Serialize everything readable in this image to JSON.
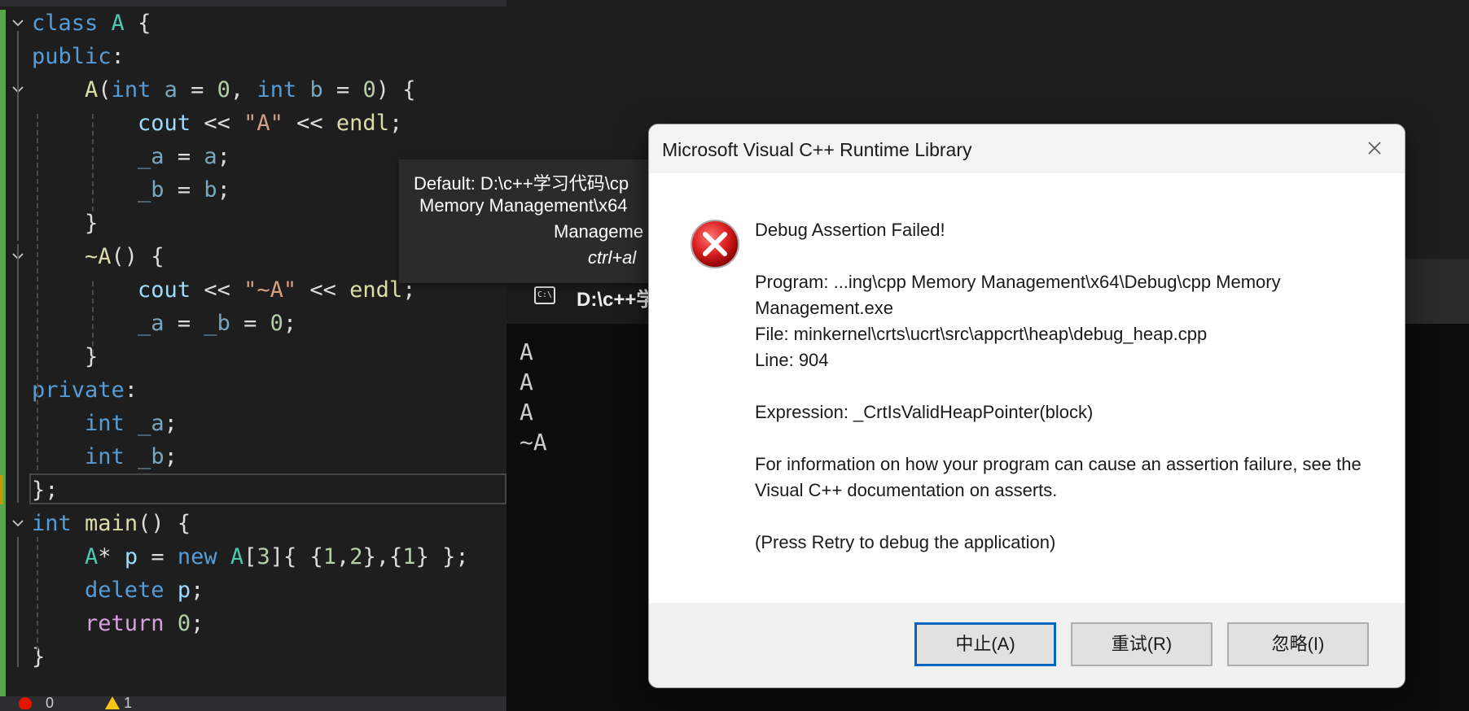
{
  "editor": {
    "lines": [
      {
        "fold": true,
        "html": "<span class=\"kw\">class</span> <span class=\"cls\">A</span> {"
      },
      {
        "fold": false,
        "html": "<span class=\"kw\">public</span>:"
      },
      {
        "fold": true,
        "html": "    <span class=\"fn\">A</span>(<span class=\"kw\">int</span> <span class=\"var dim\">a</span> = <span class=\"num\">0</span>, <span class=\"kw\">int</span> <span class=\"var dim\">b</span> = <span class=\"num\">0</span>) {"
      },
      {
        "fold": false,
        "html": "        <span class=\"var\">cout</span> &lt;&lt; <span class=\"str\">\"A\"</span> &lt;&lt; <span class=\"fn\">endl</span>;"
      },
      {
        "fold": false,
        "html": "        <span class=\"var dim\">_a</span> = <span class=\"var dim\">a</span>;"
      },
      {
        "fold": false,
        "html": "        <span class=\"var dim\">_b</span> = <span class=\"var dim\">b</span>;"
      },
      {
        "fold": false,
        "html": "    }"
      },
      {
        "fold": true,
        "html": "    <span class=\"fn\">~A</span>() {"
      },
      {
        "fold": false,
        "html": "        <span class=\"var\">cout</span> &lt;&lt; <span class=\"str\">\"~A\"</span> &lt;&lt; <span class=\"fn\">endl</span>;"
      },
      {
        "fold": false,
        "html": "        <span class=\"var dim\">_a</span> = <span class=\"var dim\">_b</span> = <span class=\"num\">0</span>;"
      },
      {
        "fold": false,
        "html": "    }"
      },
      {
        "fold": false,
        "html": "<span class=\"kw\">private</span>:"
      },
      {
        "fold": false,
        "html": "    <span class=\"kw\">int</span> <span class=\"var dim\">_a</span>;"
      },
      {
        "fold": false,
        "html": "    <span class=\"kw\">int</span> <span class=\"var dim\">_b</span>;"
      },
      {
        "fold": false,
        "html": "};"
      },
      {
        "fold": true,
        "html": "<span class=\"kw\">int</span> <span class=\"fn\">main</span>() {"
      },
      {
        "fold": false,
        "html": "    <span class=\"cls\">A</span>* <span class=\"var\">p</span> = <span class=\"kw\">new</span> <span class=\"cls\">A</span>[<span class=\"num\">3</span>]{ {<span class=\"num\">1</span>,<span class=\"num\">2</span>},{<span class=\"num\">1</span>} };"
      },
      {
        "fold": false,
        "html": "    <span class=\"kw\">delete</span> <span class=\"var\">p</span>;"
      },
      {
        "fold": false,
        "html": "    <span class=\"ctl\">return</span> <span class=\"num\">0</span>;"
      },
      {
        "fold": false,
        "html": "}"
      }
    ],
    "status": {
      "errors": "0",
      "warnings": "1"
    }
  },
  "tooltip": {
    "line1": "Default: D:\\c++学习代码\\cp",
    "line2": "Memory Management\\x64",
    "line3": "Manageme",
    "line4": "ctrl+al"
  },
  "console": {
    "title": "D:\\c++学",
    "icon_label": "C:\\",
    "output": "A\nA\nA\n~A"
  },
  "dialog": {
    "title": "Microsoft Visual C++ Runtime Library",
    "heading": "Debug Assertion Failed!",
    "program": "Program: ...ing\\cpp Memory Management\\x64\\Debug\\cpp Memory Management.exe",
    "file": "File: minkernel\\crts\\ucrt\\src\\appcrt\\heap\\debug_heap.cpp",
    "line": "Line: 904",
    "expression": "Expression: _CrtIsValidHeapPointer(block)",
    "info": "For information on how your program can cause an assertion failure, see the Visual C++ documentation on asserts.",
    "hint": "(Press Retry to debug the application)",
    "buttons": {
      "abort": "中止(A)",
      "retry": "重试(R)",
      "ignore": "忽略(I)"
    }
  },
  "colors": {
    "accent": "#0067c0",
    "error": "#d32f2f",
    "git_added": "#57a64a"
  }
}
